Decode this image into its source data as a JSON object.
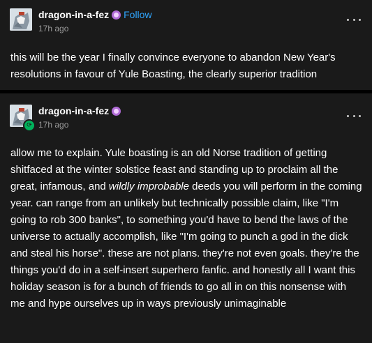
{
  "post1": {
    "username": "dragon-in-a-fez",
    "follow_label": "Follow",
    "time": "17h ago",
    "text": "this will be the year I finally convince everyone to abandon New Year's resolutions in favour of Yule Boasting, the clearly superior tradition"
  },
  "post2": {
    "username": "dragon-in-a-fez",
    "time": "17h ago",
    "text_before": "allow me to explain. Yule boasting is an old Norse tradition of getting shitfaced at the winter solstice feast and standing up to proclaim all the great, infamous, and ",
    "text_em": "wildly improbable",
    "text_after": " deeds you will perform in the coming year. can range from an unlikely but technically possible claim, like \"I'm going to rob 300 banks\", to something you'd have to bend the laws of the universe to actually accomplish, like \"I'm going to punch a god in the dick and steal his horse\". these are not plans. they're not even goals. they're the things you'd do in a self-insert superhero fanfic. and honestly all I want this holiday season is for a bunch of friends to go all in on this nonsense with me and hype ourselves up in ways previously unimaginable"
  },
  "colors": {
    "background": "#1a1a1a",
    "follow": "#2fa6ff",
    "reblog": "#00b35c",
    "badge": "#b06bd6"
  }
}
